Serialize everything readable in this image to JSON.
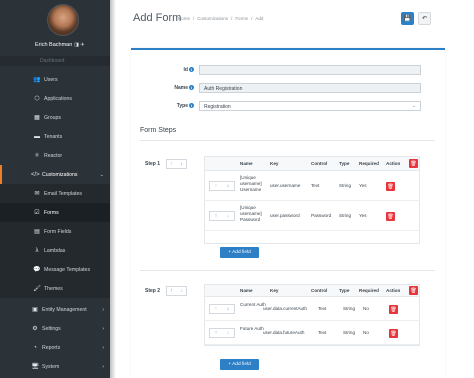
{
  "user": {
    "name": "Erich Bachman",
    "badges": "◨ ✈"
  },
  "sidebar": {
    "faded_item": "Dashboard",
    "items": [
      {
        "label": "Users",
        "icon": "users-icon",
        "glyph": "👥"
      },
      {
        "label": "Applications",
        "icon": "cube-icon",
        "glyph": "⬡"
      },
      {
        "label": "Groups",
        "icon": "groups-icon",
        "glyph": "▦"
      },
      {
        "label": "Tenants",
        "icon": "tenants-icon",
        "glyph": "▬"
      },
      {
        "label": "Reactor",
        "icon": "reactor-icon",
        "glyph": "⚛"
      }
    ],
    "customizations": {
      "label": "Customizations",
      "icon": "code-icon",
      "glyph": "</>",
      "caret": "⌄"
    },
    "sub": [
      {
        "label": "Email Templates",
        "icon": "envelope-icon",
        "glyph": "✉"
      },
      {
        "label": "Forms",
        "icon": "checkbox-icon",
        "glyph": "☑"
      },
      {
        "label": "Form Fields",
        "icon": "list-icon",
        "glyph": "▤"
      },
      {
        "label": "Lambdas",
        "icon": "lambda-icon",
        "glyph": "λ"
      },
      {
        "label": "Message Templates",
        "icon": "chat-icon",
        "glyph": "💬"
      },
      {
        "label": "Themes",
        "icon": "paint-icon",
        "glyph": "🖌"
      }
    ],
    "bottom": [
      {
        "label": "Entity Management",
        "icon": "entity-icon",
        "glyph": "▣"
      },
      {
        "label": "Settings",
        "icon": "gear-icon",
        "glyph": "⚙"
      },
      {
        "label": "Reports",
        "icon": "chart-icon",
        "glyph": "◔"
      },
      {
        "label": "System",
        "icon": "system-icon",
        "glyph": "🖥"
      }
    ],
    "caret": "›"
  },
  "header": {
    "title": "Add Form",
    "crumbs": [
      "Home",
      "Customizations",
      "Forms",
      "Add"
    ],
    "sep": "/",
    "save_glyph": "💾",
    "back_glyph": "↶"
  },
  "form": {
    "id": {
      "label": "Id",
      "value": ""
    },
    "name": {
      "label": "Name",
      "value": "Auth Registration"
    },
    "type": {
      "label": "Type",
      "value": "Registration"
    },
    "info_glyph": "i"
  },
  "steps_title": "Form Steps",
  "columns": [
    "Name",
    "Key",
    "Control",
    "Type",
    "Required",
    "Action"
  ],
  "add_field_label": "+ Add field",
  "up_glyph": "↑",
  "down_glyph": "↓",
  "del_glyph": "🗑",
  "steps": [
    {
      "label": "Step 1",
      "rows": [
        {
          "name": "[Unique username] Username",
          "key": "user.username",
          "control": "Text",
          "type": "String",
          "required": "Yes"
        },
        {
          "name": "[Unique username] Password",
          "key": "user.password",
          "control": "Password",
          "type": "String",
          "required": "Yes"
        }
      ]
    },
    {
      "label": "Step 2",
      "rows": [
        {
          "name": "Current Auth",
          "key": "user.data.currentAuth",
          "control": "Text",
          "type": "String",
          "required": "No"
        },
        {
          "name": "Future Auth",
          "key": "user.data.futureAuth",
          "control": "Text",
          "type": "String",
          "required": "No"
        }
      ]
    }
  ]
}
